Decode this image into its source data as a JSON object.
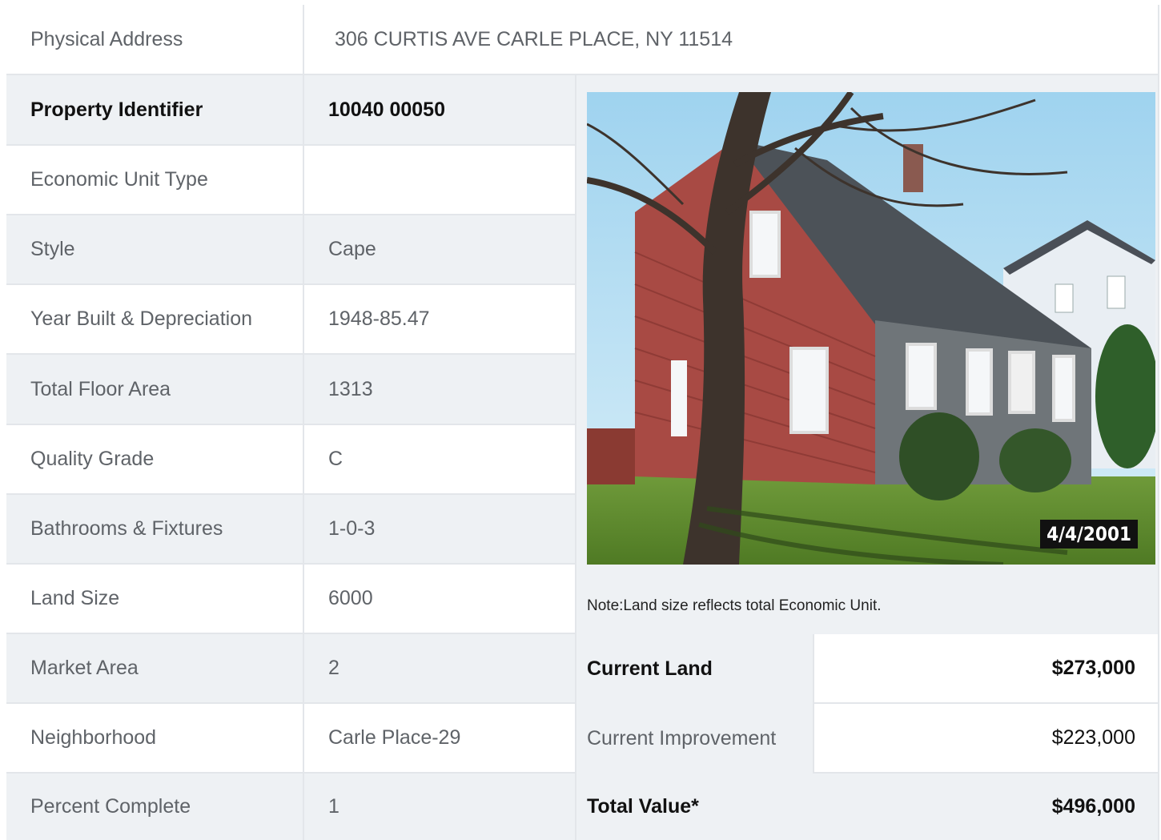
{
  "address": {
    "label": "Physical Address",
    "value": "306  CURTIS AVE  CARLE PLACE, NY  11514"
  },
  "rows": [
    {
      "label": "Property Identifier",
      "value": "10040  00050"
    },
    {
      "label": "Economic Unit Type",
      "value": ""
    },
    {
      "label": "Style",
      "value": "Cape"
    },
    {
      "label": "Year Built & Depreciation",
      "value": "1948-85.47"
    },
    {
      "label": "Total Floor Area",
      "value": "1313"
    },
    {
      "label": "Quality Grade",
      "value": "C"
    },
    {
      "label": "Bathrooms & Fixtures",
      "value": "1-0-3"
    },
    {
      "label": "Land Size",
      "value": "6000"
    },
    {
      "label": "Market Area",
      "value": "2"
    },
    {
      "label": "Neighborhood",
      "value": "Carle Place-29"
    },
    {
      "label": "Percent Complete",
      "value": "1"
    }
  ],
  "photo": {
    "date_stamp": "4/4/2001"
  },
  "note": "Note:Land size reflects total Economic Unit.",
  "values": [
    {
      "label": "Current Land",
      "value": "$273,000"
    },
    {
      "label": "Current Improvement",
      "value": "$223,000"
    },
    {
      "label": "Total Value*",
      "value": "$496,000"
    }
  ]
}
